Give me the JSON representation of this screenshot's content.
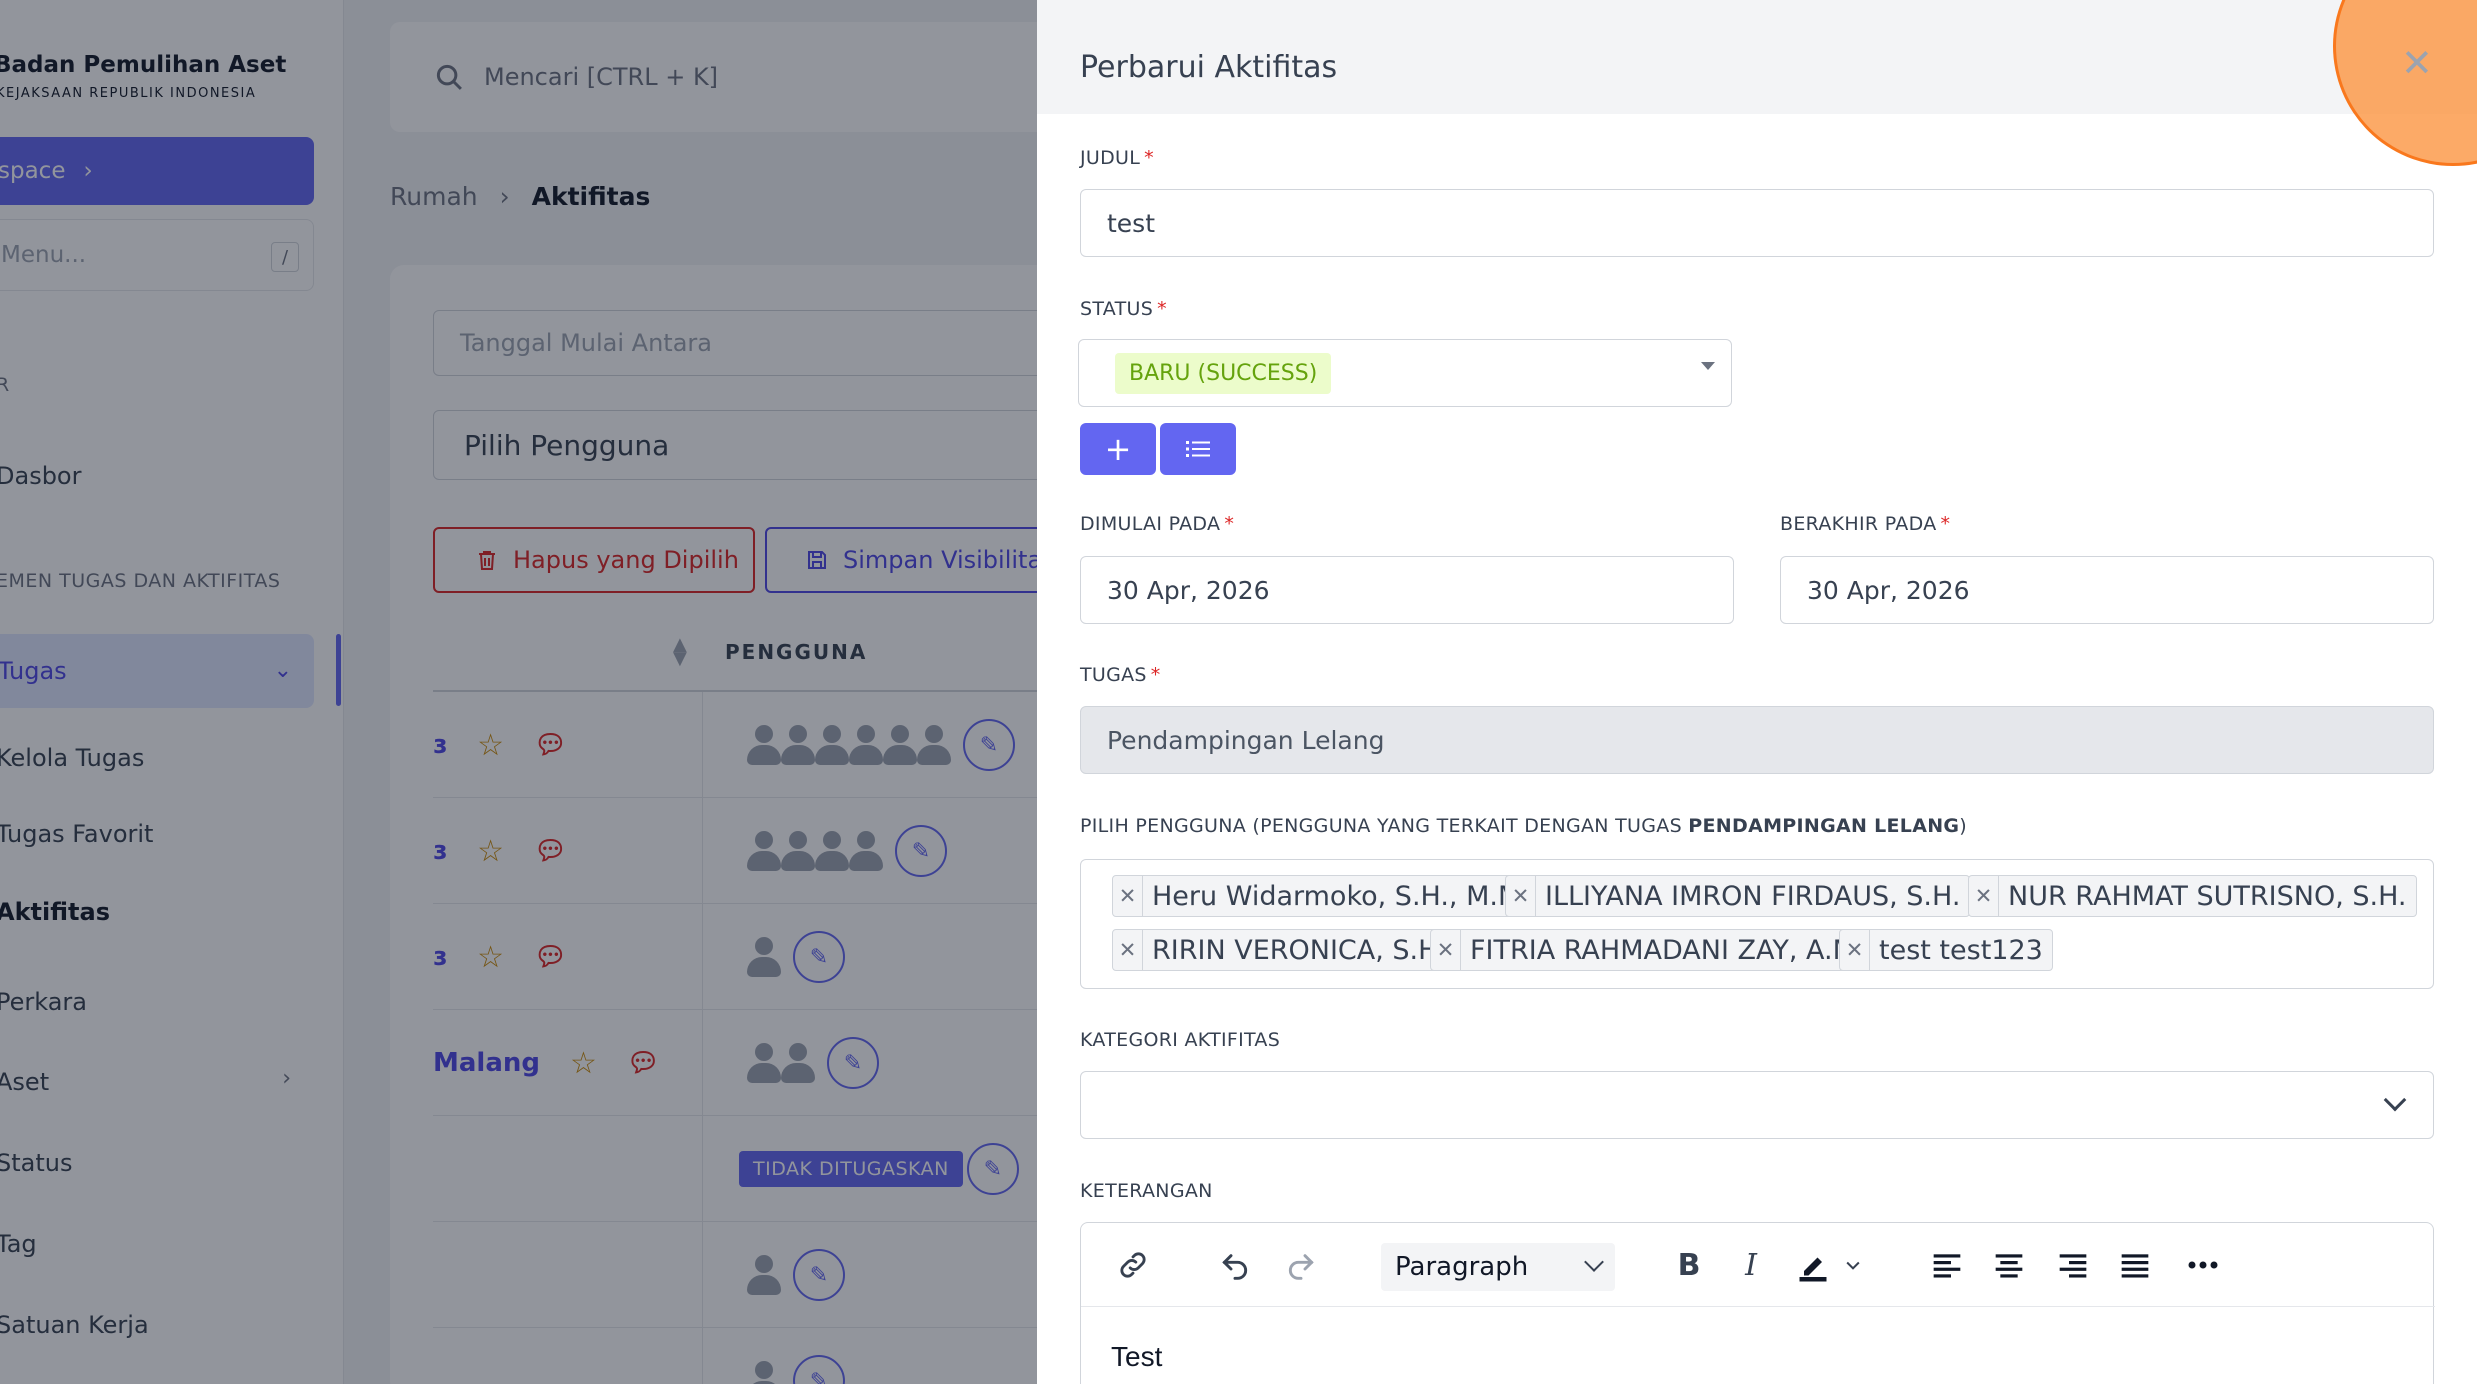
{
  "sidebar": {
    "brand_title": "Badan Pemulihan Aset",
    "brand_subtitle": "KEJAKSAAN REPUBLIK INDONESIA",
    "workspace_label": "space",
    "menu_search_placeholder": "Menu...",
    "menu_search_kbd": "/",
    "section_1": "R",
    "dashboard": "Dasbor",
    "section_2": "EMEN TUGAS DAN AKTIFITAS",
    "tugas": "Tugas",
    "kelola_tugas": "Kelola Tugas",
    "tugas_favorit": "Tugas Favorit",
    "aktifitas": "Aktifitas",
    "perkara": "Perkara",
    "aset": "Aset",
    "status": "Status",
    "tag": "Tag",
    "satuan_kerja": "Satuan Kerja"
  },
  "topbar": {
    "search_placeholder": "Mencari [CTRL + K]"
  },
  "breadcrumb": {
    "home": "Rumah",
    "current": "Aktifitas"
  },
  "list": {
    "date_filter_placeholder": "Tanggal Mulai Antara",
    "user_select_placeholder": "Pilih Pengguna",
    "delete_selected": "Hapus yang Dipilih",
    "save_visibility": "Simpan Visibilitas",
    "col_pengguna": "PENGGUNA",
    "row4_title": "Malang",
    "unassigned_badge": "TIDAK DITUGASKAN"
  },
  "drawer": {
    "title": "Perbarui Aktifitas",
    "judul_label": "JUDUL",
    "judul_value": "test",
    "status_label": "STATUS",
    "status_value": "BARU (SUCCESS)",
    "dimulai_label": "DIMULAI PADA",
    "dimulai_value": "30 Apr, 2026",
    "berakhir_label": "BERAKHIR PADA",
    "berakhir_value": "30 Apr, 2026",
    "tugas_label": "TUGAS",
    "tugas_value": "Pendampingan Lelang",
    "pengguna_label_prefix": "PILIH PENGGUNA (PENGGUNA YANG TERKAIT DENGAN TUGAS ",
    "pengguna_label_bold": "PENDAMPINGAN LELANG",
    "pengguna_label_suffix": ")",
    "users": [
      "Heru Widarmoko, S.H., M.M.",
      "ILLIYANA IMRON FIRDAUS, S.H.",
      "NUR RAHMAT SUTRISNO, S.H.",
      "RIRIN VERONICA, S.H.",
      "FITRIA RAHMADANI ZAY, A.Md.",
      "test test123"
    ],
    "kategori_label": "KATEGORI AKTIFITAS",
    "kategori_value": "",
    "keterangan_label": "KETERANGAN",
    "editor_block_format": "Paragraph",
    "editor_content": "Test"
  },
  "colors": {
    "accent": "#6366f1",
    "danger": "#dc2626",
    "status_bg": "#ecfccb",
    "status_fg": "#65a30d",
    "click_highlight": "#fb923c"
  }
}
